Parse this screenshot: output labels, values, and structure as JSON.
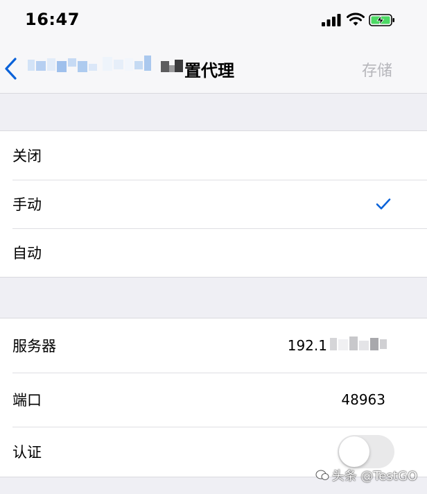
{
  "status_bar": {
    "time": "16:47",
    "icons": [
      "cellular-signal-icon",
      "wifi-icon",
      "battery-charging-icon"
    ],
    "battery_color": "#4cd964"
  },
  "nav": {
    "back_icon": "chevron-left-icon",
    "title": "置代理",
    "save_label": "存储",
    "accent_color": "#0a62d9"
  },
  "proxy_modes": {
    "items": [
      {
        "label": "关闭",
        "selected": false
      },
      {
        "label": "手动",
        "selected": true
      },
      {
        "label": "自动",
        "selected": false
      }
    ]
  },
  "manual_settings": {
    "server_label": "服务器",
    "server_value": "192.1",
    "port_label": "端口",
    "port_value": "48963",
    "auth_label": "认证",
    "auth_enabled": false
  },
  "watermark": {
    "text": "头条 @TestGO"
  }
}
